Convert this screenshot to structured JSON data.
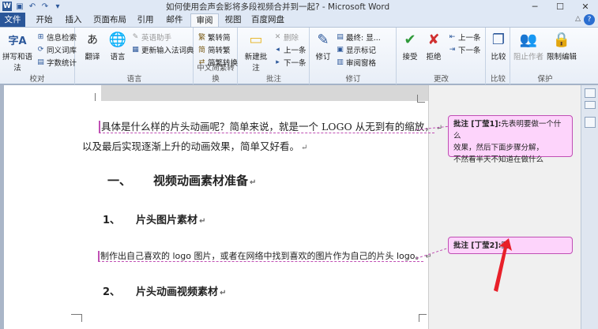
{
  "window": {
    "title": "如何使用会声会影将多段视频合并到一起? - Microsoft Word",
    "minimize": "─",
    "maximize": "☐",
    "close": "✕"
  },
  "qat": {
    "logo": "W",
    "save": "💾",
    "undo": "↶",
    "redo": "↷",
    "customize": "▾"
  },
  "tabs": [
    "文件",
    "开始",
    "插入",
    "页面布局",
    "引用",
    "邮件",
    "审阅",
    "视图",
    "百度网盘"
  ],
  "active_tab": "审阅",
  "ribbon": {
    "proofing": {
      "label": "校对",
      "spelling": "拼写和语法",
      "research": "信息检索",
      "thesaurus": "同义词库",
      "wordcount": "字数统计"
    },
    "language": {
      "label": "语言",
      "translate": "翻译",
      "language": "语言",
      "ime": "英语助手",
      "update_ime": "更新输入法词典"
    },
    "chinese": {
      "label": "中文简繁转换",
      "t2s": "繁转简",
      "s2t": "简转繁",
      "convert": "简繁转换"
    },
    "comments": {
      "label": "批注",
      "new": "新建批注",
      "delete": "删除",
      "prev": "上一条",
      "next": "下一条"
    },
    "tracking": {
      "label": "修订",
      "track": "修订",
      "final": "最终: 显...",
      "show_markup": "显示标记",
      "review_pane": "审阅窗格"
    },
    "changes": {
      "label": "更改",
      "accept": "接受",
      "reject": "拒绝",
      "prev": "上一条",
      "next": "下一条"
    },
    "compare": {
      "label": "比较",
      "compare": "比较"
    },
    "protect": {
      "label": "保护",
      "block": "阻止作者",
      "restrict": "限制编辑"
    }
  },
  "document": {
    "para1_line1": "具体是什么样的片头动画呢？简单来说，就是一个 LOGO 从无到有的缩放，",
    "para1_line2": "以及最后实现逐渐上升的动画效果，简单又好看。",
    "heading1_num": "一、",
    "heading1_text": "视频动画素材准备",
    "heading2_num": "1、",
    "heading2_text": "片头图片素材",
    "para2": "制作出自己喜欢的 logo 图片，或者在网络中找到喜欢的图片作为自己的片头 logo。",
    "heading3_num": "2、",
    "heading3_text": "片头动画视频素材",
    "para_mark": "↵"
  },
  "comments": [
    {
      "label": "批注 [丁莹1]:",
      "text_lines": [
        "先表明要做一个什么",
        "效果，然后下面步骤分解，",
        "不然看半天不知道在做什么"
      ]
    },
    {
      "label": "批注 [丁莹2]:",
      "text_lines": [
        "删"
      ]
    }
  ],
  "colors": {
    "accent": "#2a5699",
    "comment": "#c04fb4",
    "comment_bg": "#fdd4fb",
    "arrow": "#e8202a"
  }
}
